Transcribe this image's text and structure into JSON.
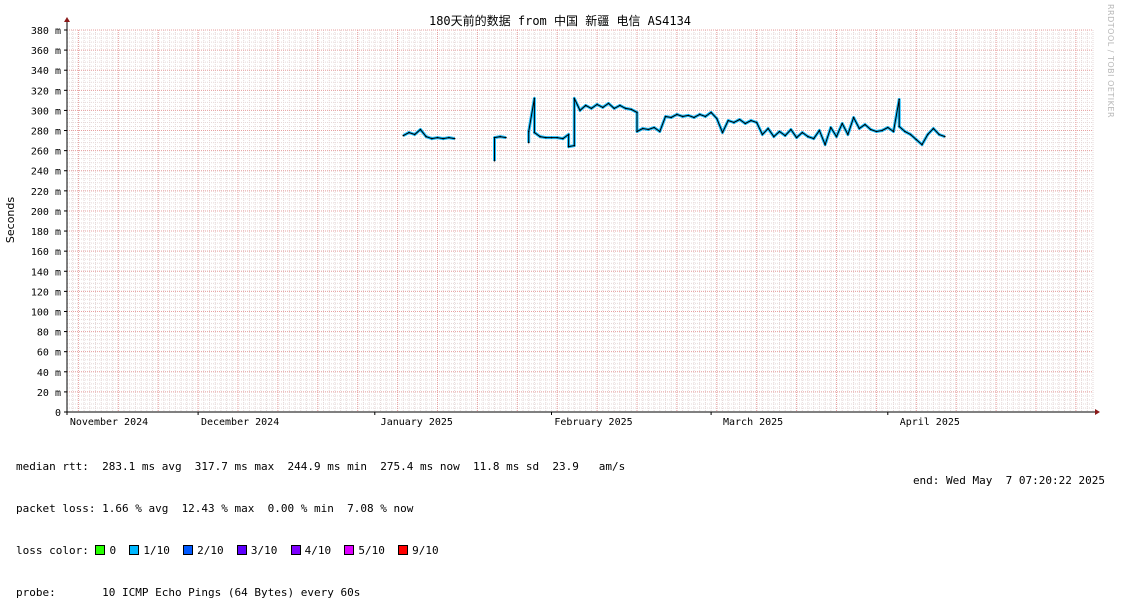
{
  "chart_data": {
    "type": "line",
    "title": "180天前的数据 from 中国 新疆 电信 AS4134",
    "ylabel": "Seconds",
    "xlabel": "",
    "ylim": [
      0,
      0.38
    ],
    "y_ticks": [
      {
        "v": 0,
        "label": "0"
      },
      {
        "v": 0.02,
        "label": "20 m"
      },
      {
        "v": 0.04,
        "label": "40 m"
      },
      {
        "v": 0.06,
        "label": "60 m"
      },
      {
        "v": 0.08,
        "label": "80 m"
      },
      {
        "v": 0.1,
        "label": "100 m"
      },
      {
        "v": 0.12,
        "label": "120 m"
      },
      {
        "v": 0.14,
        "label": "140 m"
      },
      {
        "v": 0.16,
        "label": "160 m"
      },
      {
        "v": 0.18,
        "label": "180 m"
      },
      {
        "v": 0.2,
        "label": "200 m"
      },
      {
        "v": 0.22,
        "label": "220 m"
      },
      {
        "v": 0.24,
        "label": "240 m"
      },
      {
        "v": 0.26,
        "label": "260 m"
      },
      {
        "v": 0.28,
        "label": "280 m"
      },
      {
        "v": 0.3,
        "label": "300 m"
      },
      {
        "v": 0.32,
        "label": "320 m"
      },
      {
        "v": 0.34,
        "label": "340 m"
      },
      {
        "v": 0.36,
        "label": "360 m"
      },
      {
        "v": 0.38,
        "label": "380 m"
      }
    ],
    "x_range": [
      "2024-11-08",
      "2025-05-07"
    ],
    "x_ticks": [
      {
        "date": "2024-11-01",
        "label": "November 2024"
      },
      {
        "date": "2024-12-01",
        "label": "December 2024"
      },
      {
        "date": "2025-01-01",
        "label": "January 2025"
      },
      {
        "date": "2025-02-01",
        "label": "February 2025"
      },
      {
        "date": "2025-03-01",
        "label": "March 2025"
      },
      {
        "date": "2025-04-01",
        "label": "April 2025"
      }
    ],
    "grid": true,
    "series": [
      {
        "name": "median rtt",
        "points": [
          [
            "2025-01-06",
            0.275
          ],
          [
            "2025-01-07",
            0.278
          ],
          [
            "2025-01-08",
            0.276
          ],
          [
            "2025-01-09",
            0.281
          ],
          [
            "2025-01-10",
            0.274
          ],
          [
            "2025-01-11",
            0.272
          ],
          [
            "2025-01-12",
            0.273
          ],
          [
            "2025-01-13",
            0.272
          ],
          [
            "2025-01-14",
            0.273
          ],
          [
            "2025-01-15",
            0.272
          ],
          null,
          [
            "2025-01-22",
            0.25
          ],
          [
            "2025-01-22",
            0.273
          ],
          [
            "2025-01-23",
            0.274
          ],
          [
            "2025-01-24",
            0.273
          ],
          null,
          [
            "2025-01-28",
            0.268
          ],
          [
            "2025-01-28",
            0.279
          ],
          [
            "2025-01-29",
            0.312
          ],
          [
            "2025-01-29",
            0.278
          ],
          [
            "2025-01-30",
            0.274
          ],
          [
            "2025-01-31",
            0.273
          ],
          [
            "2025-02-01",
            0.273
          ],
          [
            "2025-02-02",
            0.273
          ],
          [
            "2025-02-03",
            0.272
          ],
          [
            "2025-02-04",
            0.276
          ],
          [
            "2025-02-04",
            0.264
          ],
          [
            "2025-02-05",
            0.265
          ],
          [
            "2025-02-05",
            0.312
          ],
          [
            "2025-02-06",
            0.3
          ],
          [
            "2025-02-07",
            0.305
          ],
          [
            "2025-02-08",
            0.302
          ],
          [
            "2025-02-09",
            0.306
          ],
          [
            "2025-02-10",
            0.303
          ],
          [
            "2025-02-11",
            0.307
          ],
          [
            "2025-02-12",
            0.302
          ],
          [
            "2025-02-13",
            0.305
          ],
          [
            "2025-02-14",
            0.302
          ],
          [
            "2025-02-15",
            0.301
          ],
          [
            "2025-02-16",
            0.298
          ],
          [
            "2025-02-16",
            0.279
          ],
          [
            "2025-02-17",
            0.282
          ],
          [
            "2025-02-18",
            0.281
          ],
          [
            "2025-02-19",
            0.283
          ],
          [
            "2025-02-20",
            0.279
          ],
          [
            "2025-02-21",
            0.294
          ],
          [
            "2025-02-22",
            0.293
          ],
          [
            "2025-02-23",
            0.296
          ],
          [
            "2025-02-24",
            0.294
          ],
          [
            "2025-02-25",
            0.295
          ],
          [
            "2025-02-26",
            0.293
          ],
          [
            "2025-02-27",
            0.296
          ],
          [
            "2025-02-28",
            0.294
          ],
          [
            "2025-03-01",
            0.298
          ],
          [
            "2025-03-02",
            0.292
          ],
          [
            "2025-03-03",
            0.278
          ],
          [
            "2025-03-04",
            0.29
          ],
          [
            "2025-03-05",
            0.288
          ],
          [
            "2025-03-06",
            0.291
          ],
          [
            "2025-03-07",
            0.287
          ],
          [
            "2025-03-08",
            0.29
          ],
          [
            "2025-03-09",
            0.288
          ],
          [
            "2025-03-10",
            0.276
          ],
          [
            "2025-03-11",
            0.282
          ],
          [
            "2025-03-12",
            0.274
          ],
          [
            "2025-03-13",
            0.279
          ],
          [
            "2025-03-14",
            0.275
          ],
          [
            "2025-03-15",
            0.281
          ],
          [
            "2025-03-16",
            0.273
          ],
          [
            "2025-03-17",
            0.278
          ],
          [
            "2025-03-18",
            0.274
          ],
          [
            "2025-03-19",
            0.272
          ],
          [
            "2025-03-20",
            0.28
          ],
          [
            "2025-03-21",
            0.266
          ],
          [
            "2025-03-22",
            0.283
          ],
          [
            "2025-03-23",
            0.274
          ],
          [
            "2025-03-24",
            0.287
          ],
          [
            "2025-03-25",
            0.276
          ],
          [
            "2025-03-26",
            0.293
          ],
          [
            "2025-03-27",
            0.282
          ],
          [
            "2025-03-28",
            0.286
          ],
          [
            "2025-03-29",
            0.281
          ],
          [
            "2025-03-30",
            0.279
          ],
          [
            "2025-03-31",
            0.28
          ],
          [
            "2025-04-01",
            0.283
          ],
          [
            "2025-04-02",
            0.279
          ],
          [
            "2025-04-03",
            0.311
          ],
          [
            "2025-04-03",
            0.284
          ],
          [
            "2025-04-04",
            0.279
          ],
          [
            "2025-04-05",
            0.276
          ],
          [
            "2025-04-06",
            0.271
          ],
          [
            "2025-04-07",
            0.266
          ],
          [
            "2025-04-08",
            0.276
          ],
          [
            "2025-04-09",
            0.282
          ],
          [
            "2025-04-10",
            0.276
          ],
          [
            "2025-04-11",
            0.274
          ]
        ]
      }
    ]
  },
  "stats": {
    "median_rtt": "median rtt:  283.1 ms avg  317.7 ms max  244.9 ms min  275.4 ms now  11.8 ms sd  23.9   am/s",
    "packet_loss": "packet loss: 1.66 % avg  12.43 % max  0.00 % min  7.08 % now",
    "loss_color_label": "loss color:",
    "loss_colors": [
      {
        "label": "0",
        "color": "#26ff00"
      },
      {
        "label": "1/10",
        "color": "#00b8ff"
      },
      {
        "label": "2/10",
        "color": "#0059ff"
      },
      {
        "label": "3/10",
        "color": "#5e00ff"
      },
      {
        "label": "4/10",
        "color": "#7e00ff"
      },
      {
        "label": "5/10",
        "color": "#dd00ff"
      },
      {
        "label": "9/10",
        "color": "#ff0000"
      }
    ],
    "probe": "probe:       10 ICMP Echo Pings (64 Bytes) every 60s",
    "end_time": "end: Wed May  7 07:20:22 2025"
  },
  "branding": "RRDTOOL / TOBI OETIKER",
  "colors": {
    "grid_minor": "#e6d9d9",
    "grid_major": "#e8a0a0",
    "axis": "#000000",
    "arrow": "#8b1a1a",
    "line_dark": "#000000",
    "loss_zero": "#26ff00",
    "loss_one": "#00b8ff"
  }
}
